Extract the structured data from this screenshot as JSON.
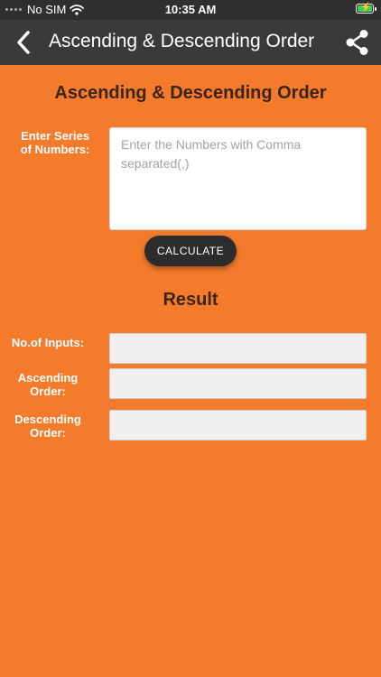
{
  "status_bar": {
    "carrier": "No SIM",
    "time": "10:35 AM"
  },
  "nav": {
    "title": "Ascending & Descending Order",
    "back_icon": "chevron-left-icon",
    "share_icon": "share-icon"
  },
  "form": {
    "heading": "Ascending & Descending Order",
    "series_label_line1": "Enter Series",
    "series_label_line2": "of Numbers:",
    "series_placeholder": "Enter the Numbers with Comma separated(,)",
    "series_value": "",
    "calculate_label": "CALCULATE"
  },
  "result": {
    "title": "Result",
    "inputs_label": "No.of Inputs:",
    "inputs_value": "",
    "ascending_label_line1": "Ascending",
    "ascending_label_line2": "Order:",
    "ascending_value": "",
    "descending_label_line1": "Descending",
    "descending_label_line2": "Order:",
    "descending_value": ""
  },
  "colors": {
    "background": "#f47b2c",
    "nav_bar": "#3a3a3a",
    "heading_text": "#3b2415",
    "button": "#2c2c2c",
    "battery_fill": "#3fd05b"
  }
}
